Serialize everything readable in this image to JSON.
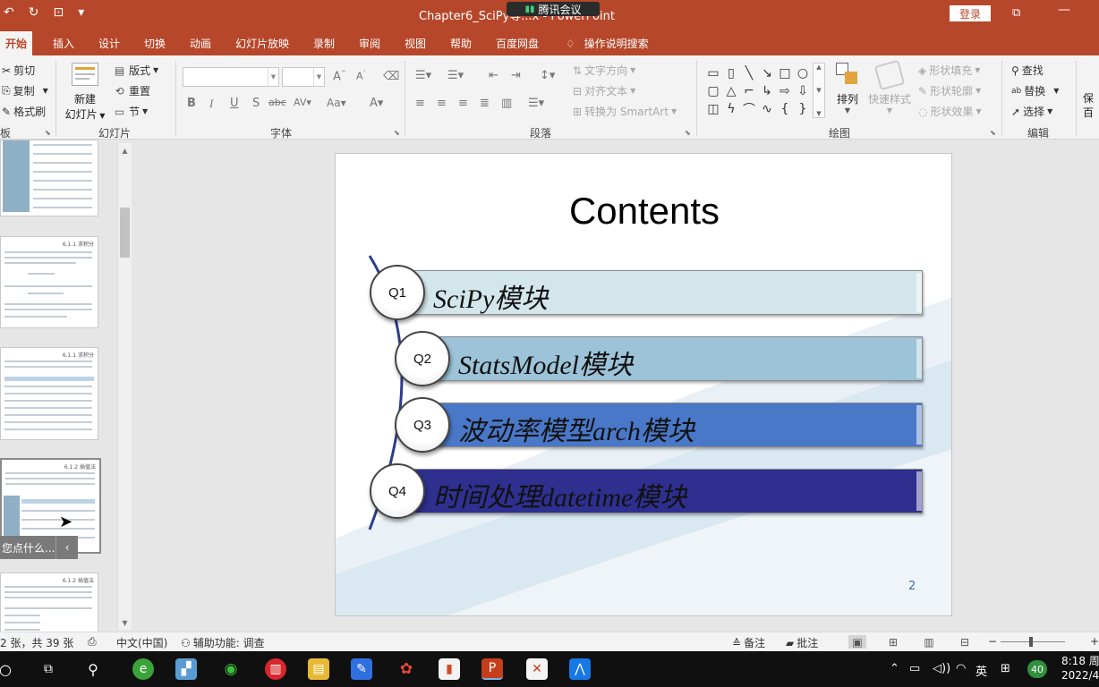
{
  "titlebar": {
    "title": "Chapter6_SciPy等...x - PowerPoint",
    "meeting": "腾讯会议",
    "login": "登录"
  },
  "tabs": [
    "开始",
    "插入",
    "设计",
    "切换",
    "动画",
    "幻灯片放映",
    "录制",
    "审阅",
    "视图",
    "帮助",
    "百度网盘"
  ],
  "tell_me": "操作说明搜索",
  "ribbon": {
    "clipboard": {
      "cut": "剪切",
      "copy": "复制",
      "format_painter": "格式刷",
      "group": "板"
    },
    "slides": {
      "new_slide_line1": "新建",
      "new_slide_line2": "幻灯片",
      "layout": "版式",
      "reset": "重置",
      "section": "节",
      "group": "幻灯片"
    },
    "font": {
      "group": "字体"
    },
    "paragraph": {
      "text_direction": "文字方向",
      "align_text": "对齐文本",
      "smartart": "转换为 SmartArt",
      "group": "段落"
    },
    "drawing": {
      "arrange": "排列",
      "quick_styles": "快速样式",
      "shape_fill": "形状填充",
      "shape_outline": "形状轮廓",
      "shape_effects": "形状效果",
      "group": "绘图"
    },
    "editing": {
      "find": "查找",
      "replace": "替换",
      "select": "选择",
      "group": "编辑"
    },
    "save": {
      "line1": "保",
      "line2": "百"
    }
  },
  "thumbs_panel": {
    "tooltip": "您点什么...",
    "thumb_titles": [
      "6.1.1 求积分",
      "6.1.1 求积分",
      "6.1.2 插值法",
      "6.1.2 插值法"
    ]
  },
  "slide": {
    "title": "Contents",
    "page_number": "2",
    "items": [
      {
        "tag": "Q1",
        "label": "SciPy模块",
        "color": "#d3e6ec",
        "text_color": "#111111"
      },
      {
        "tag": "Q2",
        "label": "StatsModel模块",
        "color": "#9cc3d8",
        "text_color": "#111111"
      },
      {
        "tag": "Q3",
        "label": "波动率模型arch模块",
        "color": "#4a78c8",
        "text_color": "#111111"
      },
      {
        "tag": "Q4",
        "label": "时间处理datetime模块",
        "color": "#2e2f8f",
        "text_color": "#111111"
      }
    ]
  },
  "statusbar": {
    "slide_count": "2 张，共 39 张",
    "language": "中文(中国)",
    "accessibility": "辅助功能: 调查",
    "notes": "备注",
    "comments": "批注"
  },
  "taskbar": {
    "ime": "英",
    "badge": "40",
    "time": "8:18 周",
    "date": "2022/4/"
  }
}
